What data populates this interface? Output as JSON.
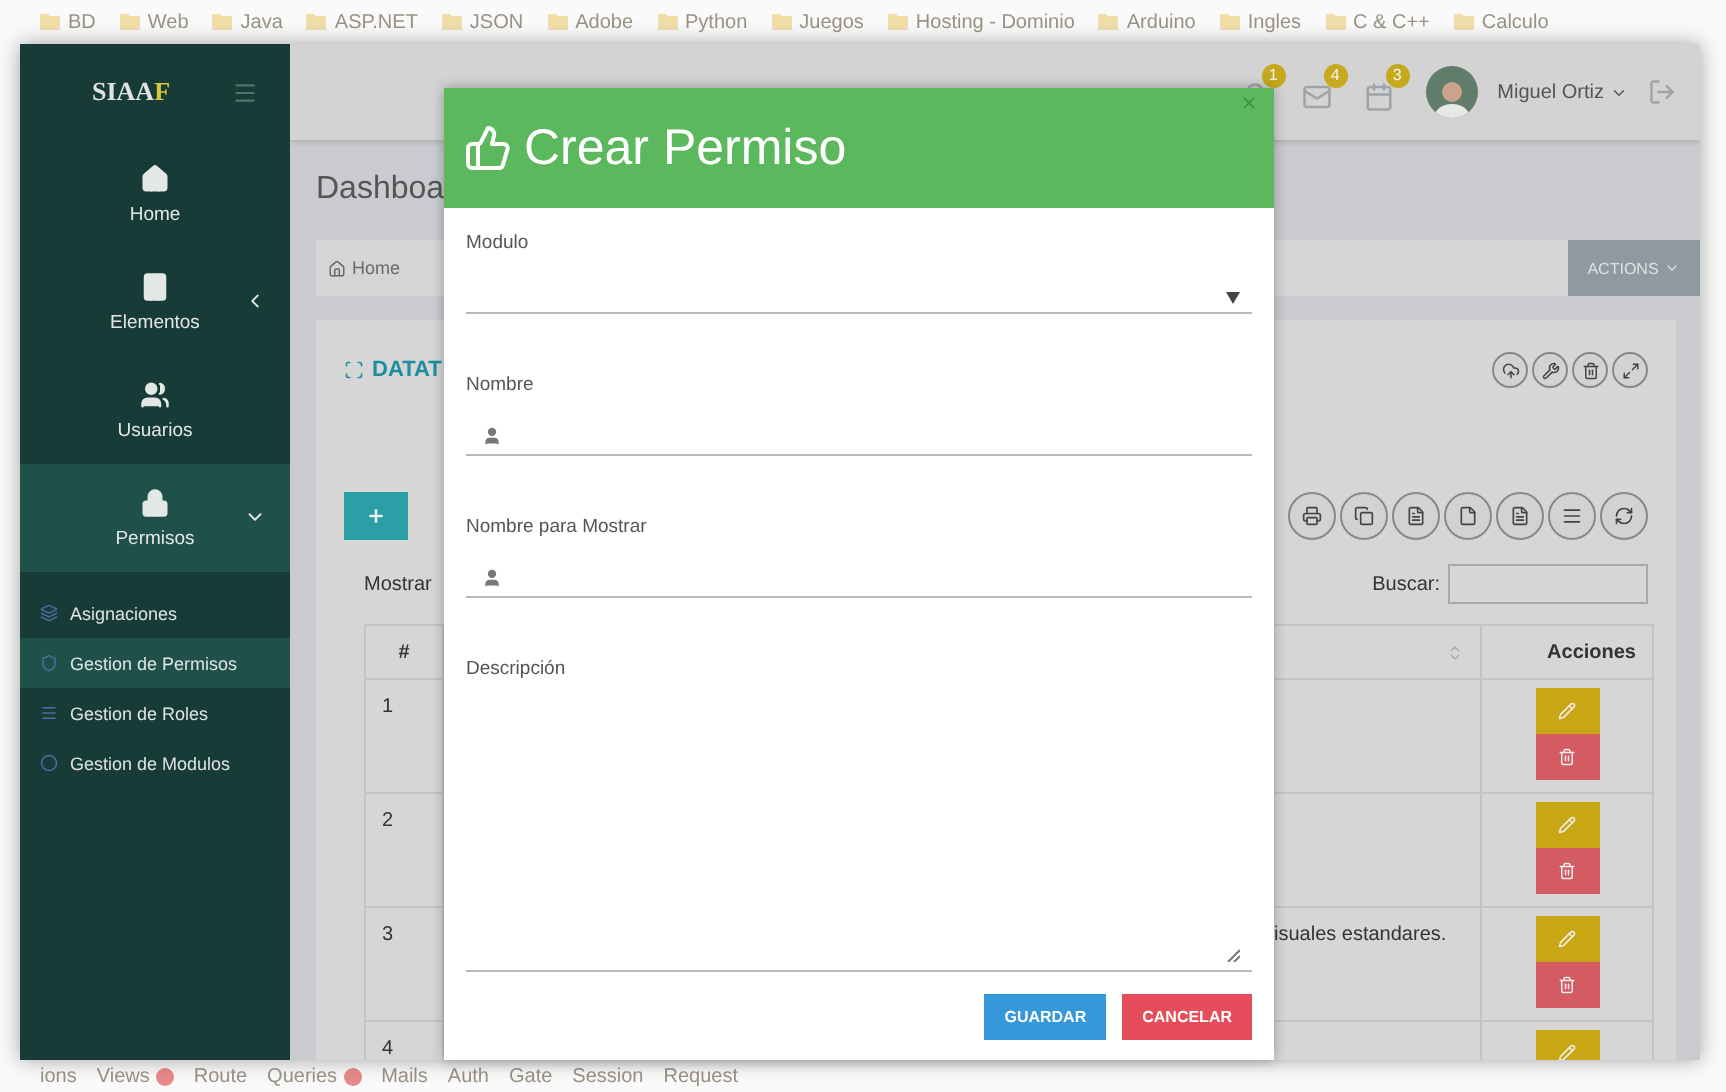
{
  "bookmarks": [
    "BD",
    "Web",
    "Java",
    "ASP.NET",
    "JSON",
    "Adobe",
    "Python",
    "Juegos",
    "Hosting - Dominio",
    "Arduino",
    "Ingles",
    "C & C++",
    "Calculo"
  ],
  "sidebar": {
    "brand": "SIAA",
    "brand_accent": "F",
    "items": [
      {
        "kind": "home",
        "label": "Home",
        "selected": false,
        "expanded": false,
        "caret": false
      },
      {
        "kind": "building",
        "label": "Elementos",
        "selected": false,
        "expanded": false,
        "caret": true
      },
      {
        "kind": "users",
        "label": "Usuarios",
        "selected": false,
        "expanded": false,
        "caret": false
      },
      {
        "kind": "lock",
        "label": "Permisos",
        "selected": true,
        "expanded": true,
        "caret": true
      }
    ],
    "subitems": [
      {
        "kind": "layers",
        "label": "Asignaciones",
        "selected": false
      },
      {
        "kind": "shield",
        "label": "Gestion de Permisos",
        "selected": true
      },
      {
        "kind": "list",
        "label": "Gestion de Roles",
        "selected": false
      },
      {
        "kind": "circle",
        "label": "Gestion de Modulos",
        "selected": false
      }
    ]
  },
  "header": {
    "notifications": [
      {
        "kind": "bell",
        "count": "1"
      },
      {
        "kind": "mail",
        "count": "4"
      },
      {
        "kind": "calendar",
        "count": "3"
      }
    ],
    "user": "Miguel Ortiz"
  },
  "page": {
    "title": "Dashboa",
    "breadcrumb": "Home",
    "actions": "ACTIONS",
    "card_title": "DATAT",
    "mostrar": "Mostrar",
    "buscar": "Buscar:",
    "table": {
      "columns": [
        "#",
        "Acciones"
      ],
      "rows": [
        {
          "number": "1",
          "text": ""
        },
        {
          "number": "2",
          "text": ""
        },
        {
          "number": "3",
          "text": "isuales estandares."
        },
        {
          "number": "4",
          "text": ""
        }
      ]
    }
  },
  "modal": {
    "title": "Crear Permiso",
    "fields": [
      {
        "kind": "select",
        "label": "Modulo"
      },
      {
        "kind": "text",
        "label": "Nombre"
      },
      {
        "kind": "text",
        "label": "Nombre para Mostrar"
      },
      {
        "kind": "textarea",
        "label": "Descripción"
      }
    ],
    "buttons": [
      {
        "kind": "primary",
        "label": "GUARDAR"
      },
      {
        "kind": "danger",
        "label": "CANCELAR"
      }
    ]
  },
  "debugbar": [
    {
      "label": "ions",
      "badge": false
    },
    {
      "label": "Views",
      "badge": true
    },
    {
      "label": "Route",
      "badge": false
    },
    {
      "label": "Queries",
      "badge": true
    },
    {
      "label": "Mails",
      "badge": false
    },
    {
      "label": "Auth",
      "badge": false
    },
    {
      "label": "Gate",
      "badge": false
    },
    {
      "label": "Session",
      "badge": false
    },
    {
      "label": "Request",
      "badge": false
    }
  ]
}
